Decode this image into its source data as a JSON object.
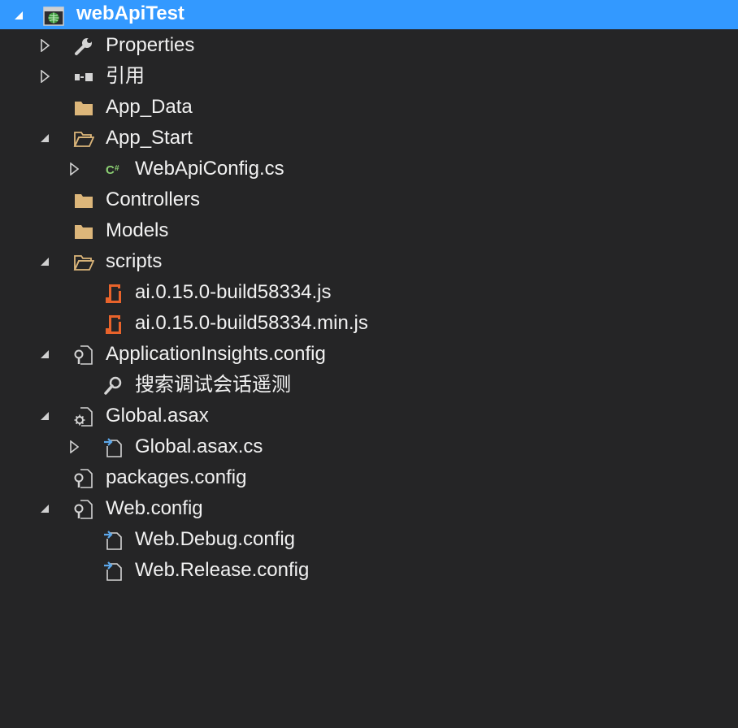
{
  "theme": {
    "background": "#252526",
    "selection": "#3399ff",
    "text": "#f1f1f1",
    "folder": "#dcb67a",
    "script": "#e8632b",
    "csharp": "#8ccf73",
    "doc": "#5ca7ea",
    "config": "#d4d4d4"
  },
  "tree": {
    "project": {
      "label": "webApiTest",
      "icon": "web-project-icon",
      "expanded": true
    },
    "items": [
      {
        "label": "Properties",
        "icon": "wrench-icon",
        "expander": "collapsed"
      },
      {
        "label": "引用",
        "icon": "references-icon",
        "expander": "collapsed"
      },
      {
        "label": "App_Data",
        "icon": "folder-icon",
        "expander": "none"
      },
      {
        "label": "App_Start",
        "icon": "folder-open-icon",
        "expander": "expanded"
      },
      {
        "label": "WebApiConfig.cs",
        "icon": "csharp-file-icon",
        "expander": "collapsed"
      },
      {
        "label": "Controllers",
        "icon": "folder-icon",
        "expander": "none"
      },
      {
        "label": "Models",
        "icon": "folder-icon",
        "expander": "none"
      },
      {
        "label": "scripts",
        "icon": "folder-open-icon",
        "expander": "expanded"
      },
      {
        "label": "ai.0.15.0-build58334.js",
        "icon": "javascript-file-icon",
        "expander": "none"
      },
      {
        "label": "ai.0.15.0-build58334.min.js",
        "icon": "javascript-file-icon",
        "expander": "none"
      },
      {
        "label": "ApplicationInsights.config",
        "icon": "config-file-icon",
        "expander": "expanded"
      },
      {
        "label": "搜索调试会话遥测",
        "icon": "search-icon",
        "expander": "none"
      },
      {
        "label": "Global.asax",
        "icon": "asax-file-icon",
        "expander": "expanded"
      },
      {
        "label": "Global.asax.cs",
        "icon": "code-file-icon",
        "expander": "collapsed"
      },
      {
        "label": "packages.config",
        "icon": "config-file-icon",
        "expander": "none"
      },
      {
        "label": "Web.config",
        "icon": "config-file-icon",
        "expander": "expanded"
      },
      {
        "label": "Web.Debug.config",
        "icon": "transform-file-icon",
        "expander": "none"
      },
      {
        "label": "Web.Release.config",
        "icon": "transform-file-icon",
        "expander": "none"
      }
    ]
  }
}
